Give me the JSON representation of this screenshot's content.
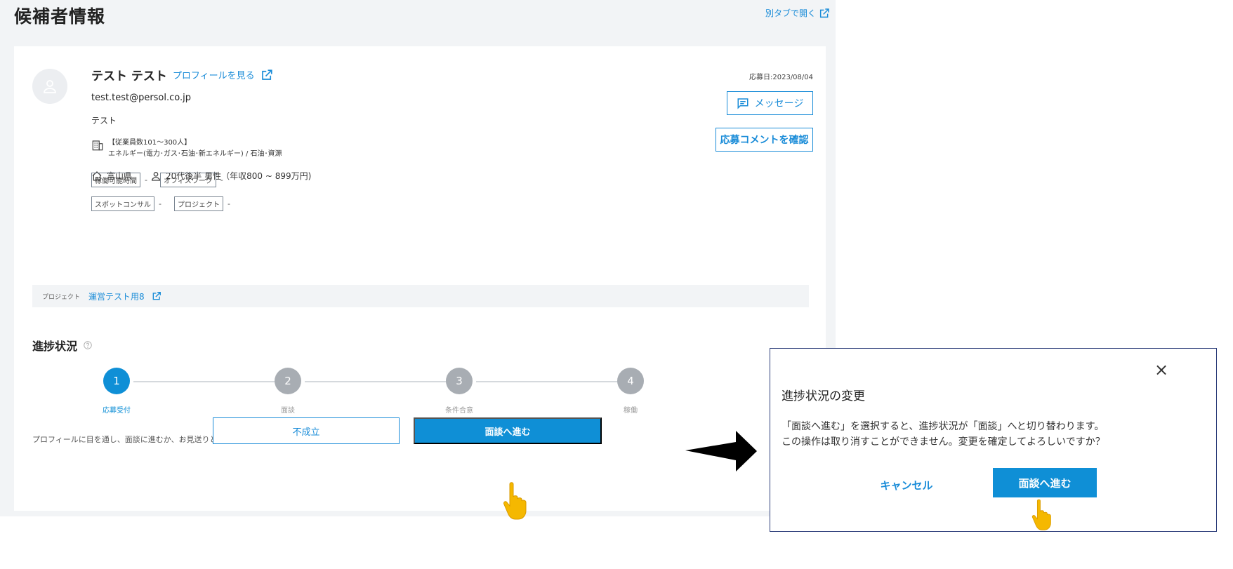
{
  "header": {
    "title": "候補者情報",
    "open_new_tab": "別タブで開く"
  },
  "candidate": {
    "name": "テスト テスト",
    "profile_link": "プロフィールを見る",
    "email": "test.test@persol.co.jp",
    "sub_name": "テスト",
    "company_size": "【従業員数101～300人】",
    "industry": "エネルギー(電力･ガス･石油･新エネルギー) / 石油･資源",
    "location": "富山県",
    "profile_summary": "20代後半 男性（年収800 ~ 899万円)",
    "tags": [
      {
        "label": "稼働可能時間",
        "value": "-"
      },
      {
        "label": "オフィスワーク",
        "value": "-"
      },
      {
        "label": "スポットコンサル",
        "value": "-"
      },
      {
        "label": "プロジェクト",
        "value": "-"
      }
    ],
    "apply_date": "応募日:2023/08/04",
    "message_button": "メッセージ",
    "comment_button": "応募コメントを確認"
  },
  "project": {
    "label": "プロジェクト",
    "name": "運営テスト用8"
  },
  "progress": {
    "title": "進捗状況",
    "steps": [
      {
        "number": "1",
        "label": "応募受付",
        "active": true
      },
      {
        "number": "2",
        "label": "面談",
        "active": false
      },
      {
        "number": "3",
        "label": "条件合意",
        "active": false
      },
      {
        "number": "4",
        "label": "稼働",
        "active": false
      }
    ],
    "advice": "プロフィールに目を通し、面談に進むか、お見送りとするかを判断しましょう。",
    "reject_button": "不成立",
    "interview_button": "面談へ進む"
  },
  "dialog": {
    "close_symbol": "×",
    "title": "進捗状況の変更",
    "line1": "「面談へ進む」を選択すると、進捗状況が「面談」へと切り替わります。",
    "line2": "この操作は取り消すことができません。変更を確定してよろしいですか？",
    "cancel_button": "キャンセル",
    "confirm_button": "面談へ進む"
  },
  "colors": {
    "accent": "#0f8fd6",
    "link": "#1a8cd8",
    "inactive_step": "#a8adb3",
    "dialog_border": "#2d3e7a",
    "pointer_hand": "#f5b800"
  },
  "icons": [
    "external-link-icon",
    "avatar-icon",
    "building-icon",
    "home-icon",
    "person-icon",
    "message-icon",
    "help-icon",
    "close-icon",
    "pointer-hand-icon",
    "arrow-right-icon"
  ]
}
